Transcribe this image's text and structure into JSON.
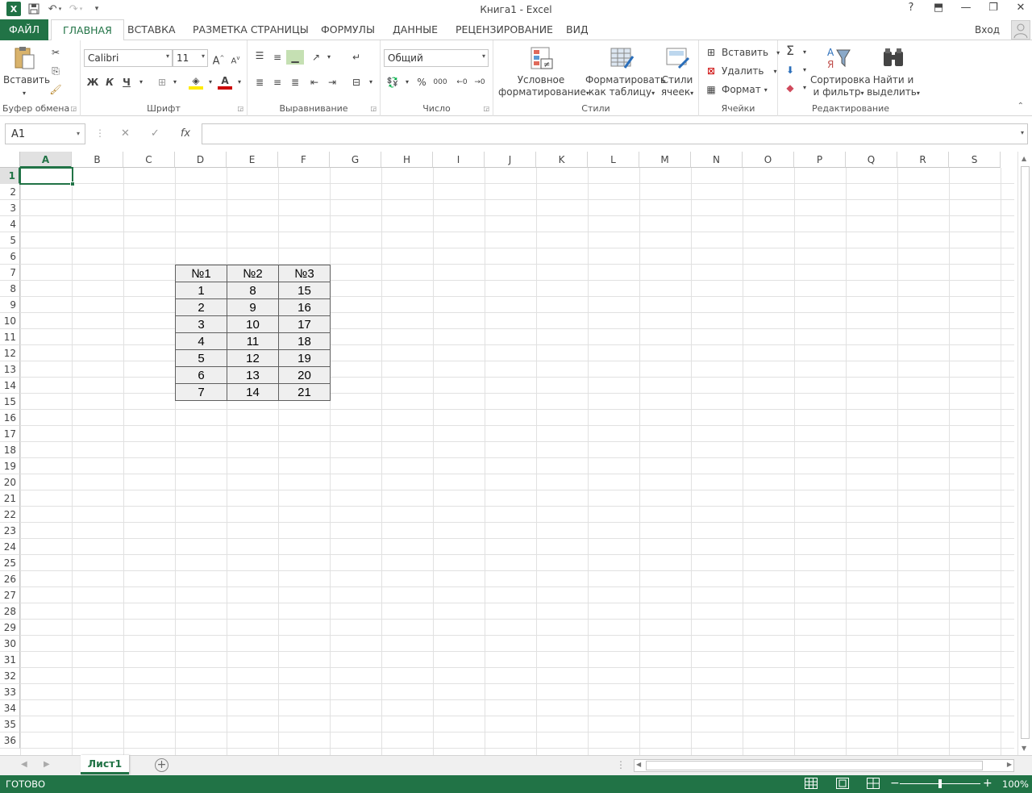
{
  "window": {
    "title": "Книга1 - Excel",
    "help": "?",
    "restore_ribbon": "⬒",
    "minimize": "—",
    "maximize": "❐",
    "close": "✕"
  },
  "tabs": [
    {
      "label": "ФАЙЛ"
    },
    {
      "label": "ГЛАВНАЯ"
    },
    {
      "label": "ВСТАВКА"
    },
    {
      "label": "РАЗМЕТКА СТРАНИЦЫ"
    },
    {
      "label": "ФОРМУЛЫ"
    },
    {
      "label": "ДАННЫЕ"
    },
    {
      "label": "РЕЦЕНЗИРОВАНИЕ"
    },
    {
      "label": "ВИД"
    }
  ],
  "signin": "Вход",
  "ribbon": {
    "clipboard": {
      "label": "Буфер обмена",
      "paste": "Вставить"
    },
    "font": {
      "label": "Шрифт",
      "name": "Calibri",
      "size": "11",
      "bold": "Ж",
      "italic": "К",
      "underline": "Ч",
      "grow": "A",
      "shrink": "A"
    },
    "alignment": {
      "label": "Выравнивание"
    },
    "number": {
      "label": "Число",
      "format": "Общий",
      "percent": "%",
      "thousands": "000"
    },
    "styles": {
      "label": "Стили",
      "conditional_1": "Условное",
      "conditional_2": "форматирование",
      "table_1": "Форматировать",
      "table_2": "как таблицу",
      "cell_1": "Стили",
      "cell_2": "ячеек"
    },
    "cells": {
      "label": "Ячейки",
      "insert": "Вставить",
      "delete": "Удалить",
      "format": "Формат"
    },
    "editing": {
      "label": "Редактирование",
      "sort_1": "Сортировка",
      "sort_2": "и фильтр",
      "find_1": "Найти и",
      "find_2": "выделить"
    }
  },
  "formula_bar": {
    "name_box": "A1",
    "cancel": "✕",
    "enter": "✓",
    "fx": "fx",
    "value": ""
  },
  "columns": [
    "A",
    "B",
    "C",
    "D",
    "E",
    "F",
    "G",
    "H",
    "I",
    "J",
    "K",
    "L",
    "M",
    "N",
    "O",
    "P",
    "Q",
    "R",
    "S"
  ],
  "rows": [
    "1",
    "2",
    "3",
    "4",
    "5",
    "6",
    "7",
    "8",
    "9",
    "10",
    "11",
    "12",
    "13",
    "14",
    "15",
    "16",
    "17",
    "18",
    "19",
    "20",
    "21",
    "22",
    "23",
    "24",
    "25",
    "26",
    "27",
    "28",
    "29",
    "30",
    "31",
    "32",
    "33",
    "34",
    "35",
    "36"
  ],
  "table": {
    "headers": [
      "№1",
      "№2",
      "№3"
    ],
    "rows": [
      [
        "1",
        "8",
        "15"
      ],
      [
        "2",
        "9",
        "16"
      ],
      [
        "3",
        "10",
        "17"
      ],
      [
        "4",
        "11",
        "18"
      ],
      [
        "5",
        "12",
        "19"
      ],
      [
        "6",
        "13",
        "20"
      ],
      [
        "7",
        "14",
        "21"
      ]
    ]
  },
  "sheet_tab": "Лист1",
  "status": {
    "text": "ГОТОВО",
    "zoom": "100%",
    "zoom_minus": "−",
    "zoom_plus": "+"
  },
  "colors": {
    "accent": "#217346"
  }
}
